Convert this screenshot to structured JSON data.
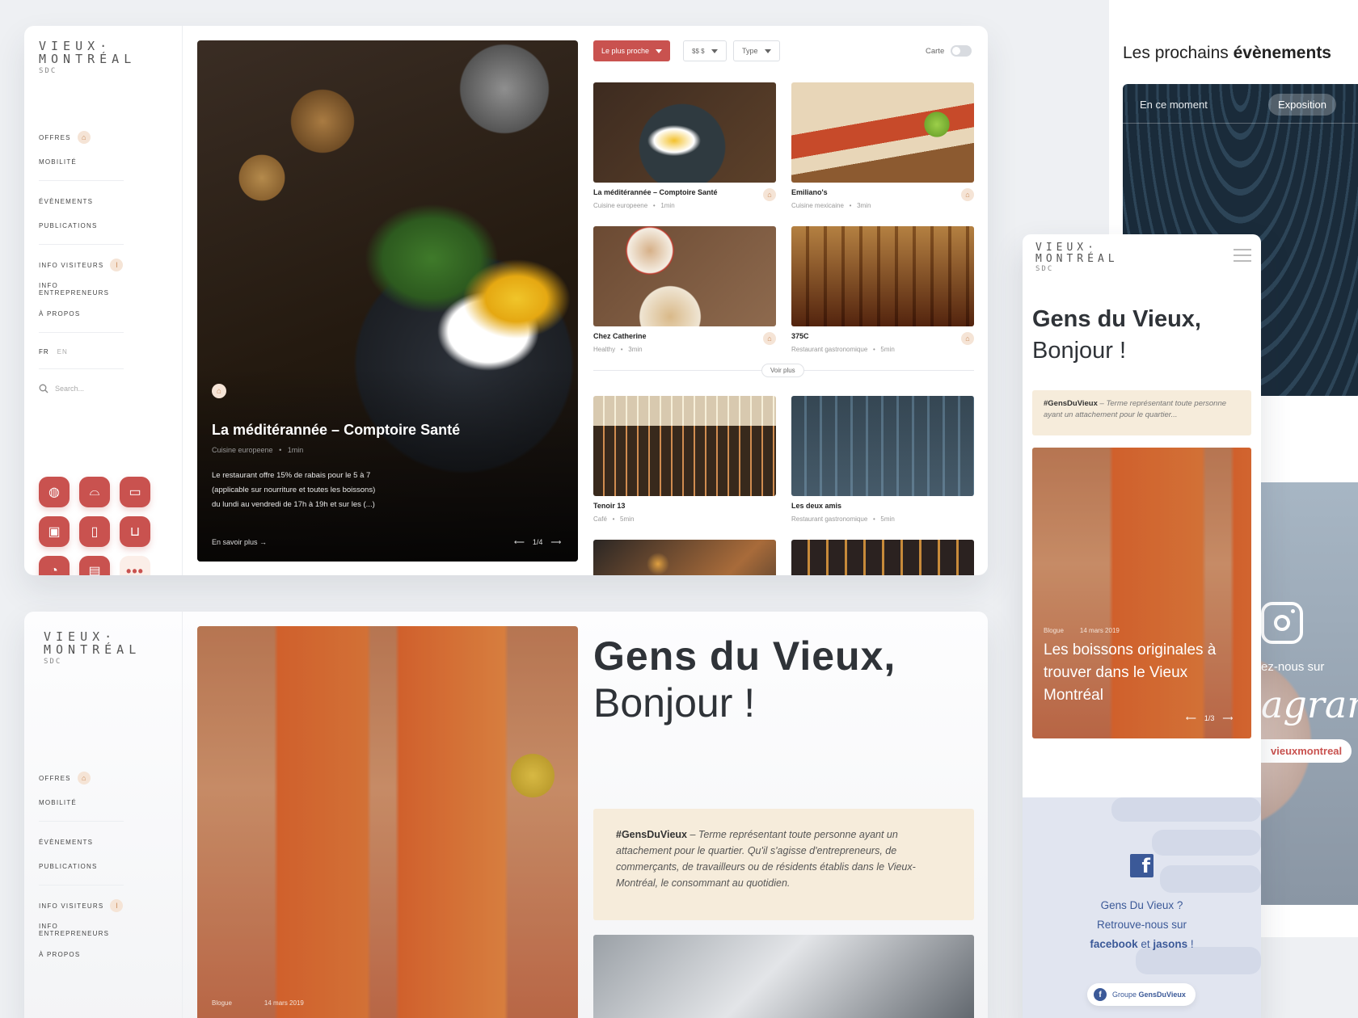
{
  "brand": {
    "line1": "VIEUX·",
    "line2": "MONTRÉAL",
    "line3": "SDC"
  },
  "nav": {
    "offres": "Offres",
    "mobilite": "Mobilité",
    "evenements": "Évènements",
    "publications": "Publications",
    "info_visiteurs": "Info visiteurs",
    "info_entrepreneurs": "Info entrepreneurs",
    "a_propos": "À propos",
    "lang_fr": "FR",
    "lang_en": "EN",
    "search_placeholder": "Search..."
  },
  "icons": [
    "restaurant-icon",
    "shopping-icon",
    "hotel-icon",
    "business-icon",
    "drink-icon",
    "basket-icon",
    "clock-icon",
    "sofa-icon",
    "more-icon"
  ],
  "hero": {
    "title": "La méditérannée – Comptoire Santé",
    "cuisine": "Cuisine europeene",
    "time": "1min",
    "desc1": "Le restaurant offre 15% de rabais pour le 5 à 7",
    "desc2": "(applicable sur nourriture et toutes les boissons)",
    "desc3": "du lundi au vendredi de 17h à 19h et sur les  (...)",
    "cta": "En savoir plus",
    "pager": "1/4"
  },
  "filters": {
    "primary": "Le plus proche",
    "price": "$$ $",
    "type": "Type",
    "map_label": "Carte"
  },
  "restaurants": [
    {
      "name": "La méditérannée – Comptoire Santé",
      "cuisine": "Cuisine europeene",
      "time": "1min"
    },
    {
      "name": "Emiliano's",
      "cuisine": "Cuisine mexicaine",
      "time": "3min"
    },
    {
      "name": "Chez Catherine",
      "cuisine": "Healthy",
      "time": "3min"
    },
    {
      "name": "375C",
      "cuisine": "Restaurant gastronomique",
      "time": "5min"
    },
    {
      "name": "Tenoir 13",
      "cuisine": "Café",
      "time": "5min"
    },
    {
      "name": "Les deux amis",
      "cuisine": "Restaurant gastronomique",
      "time": "5min"
    }
  ],
  "voir_plus": "Voir plus",
  "gens": {
    "title_bold": "Gens du Vieux,",
    "title_light": "Bonjour !",
    "tag": "#GensDuVieux",
    "quote": " – Terme représentant toute personne ayant un attachement pour le quartier. Qu'il s'agisse d'entrepreneurs, de commerçants, de travailleurs ou de résidents établis dans le Vieux-Montréal, le consommant au quotidien.",
    "quote_short": " – Terme représentant toute personne ayant un attachement pour le quartier...",
    "blog_tag": "Blogue",
    "blog_date": "14 mars 2019"
  },
  "events": {
    "heading_light": "Les prochains ",
    "heading_bold": "évènements",
    "now": "En ce moment",
    "badge": "Exposition"
  },
  "instagram": {
    "follow": "ez-nous sur",
    "word": "agram",
    "handle": "vieuxmontreal"
  },
  "mobile": {
    "title_bold": "Gens du Vieux,",
    "title_light": "Bonjour !",
    "article_tag": "Blogue",
    "article_date": "14 mars 2019",
    "article_title": "Les boissons originales à trouver dans le Vieux Montréal",
    "pager": "1/3",
    "fb_line1": "Gens Du Vieux ?",
    "fb_line2": "Retrouve-nous sur",
    "fb_line3_bold": "facebook",
    "fb_line3_mid": " et ",
    "fb_line3_bold2": "jasons",
    "fb_line3_end": " !",
    "fb_button_pre": "Groupe ",
    "fb_button_bold": "GensDuVieux"
  },
  "colors": {
    "accent": "#c9524f",
    "badge_bg": "#f5e4d6",
    "quote_bg": "#f6ecdb",
    "facebook": "#3b5998"
  }
}
